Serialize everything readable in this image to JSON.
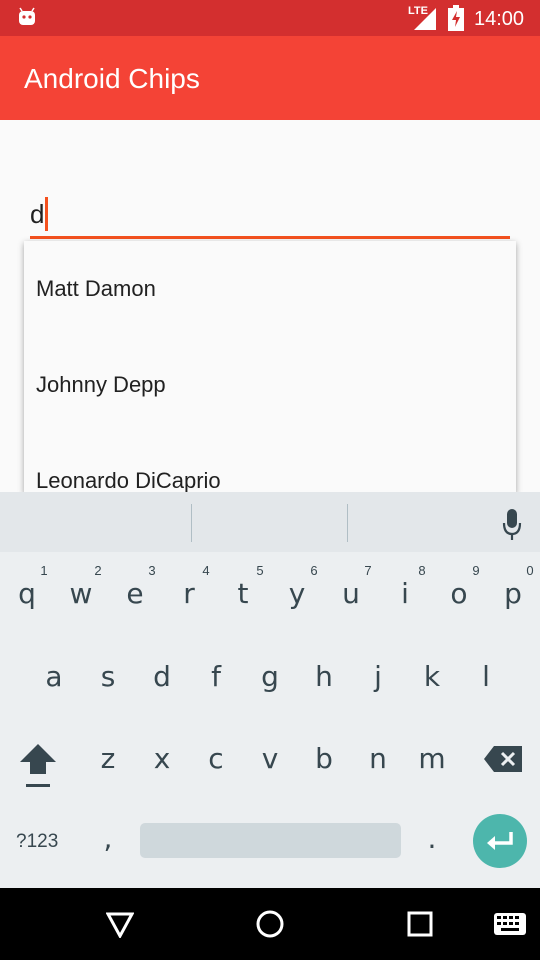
{
  "status_bar": {
    "app_icon": "android-icon",
    "network": "LTE",
    "time": "14:00"
  },
  "toolbar": {
    "title": "Android Chips"
  },
  "input": {
    "value": "d"
  },
  "suggestions": [
    "Matt Damon",
    "Johnny Depp",
    "Leonardo DiCaprio"
  ],
  "keyboard": {
    "row1": [
      {
        "key": "q",
        "hint": "1"
      },
      {
        "key": "w",
        "hint": "2"
      },
      {
        "key": "e",
        "hint": "3"
      },
      {
        "key": "r",
        "hint": "4"
      },
      {
        "key": "t",
        "hint": "5"
      },
      {
        "key": "y",
        "hint": "6"
      },
      {
        "key": "u",
        "hint": "7"
      },
      {
        "key": "i",
        "hint": "8"
      },
      {
        "key": "o",
        "hint": "9"
      },
      {
        "key": "p",
        "hint": "0"
      }
    ],
    "row2": [
      "a",
      "s",
      "d",
      "f",
      "g",
      "h",
      "j",
      "k",
      "l"
    ],
    "row3": [
      "z",
      "x",
      "c",
      "v",
      "b",
      "n",
      "m"
    ],
    "symbols_label": "?123",
    "comma": ",",
    "period": "."
  },
  "colors": {
    "status_bar": "#d32f2f",
    "toolbar": "#f44336",
    "accent": "#f4511e",
    "enter_key": "#4db6ac"
  },
  "icons": {
    "shift": "shift-icon",
    "backspace": "backspace-icon",
    "enter": "enter-icon",
    "mic": "mic-icon",
    "nav_back": "back-triangle-icon",
    "nav_home": "home-circle-icon",
    "nav_recents": "recents-square-icon",
    "nav_keyboard": "keyboard-icon"
  }
}
